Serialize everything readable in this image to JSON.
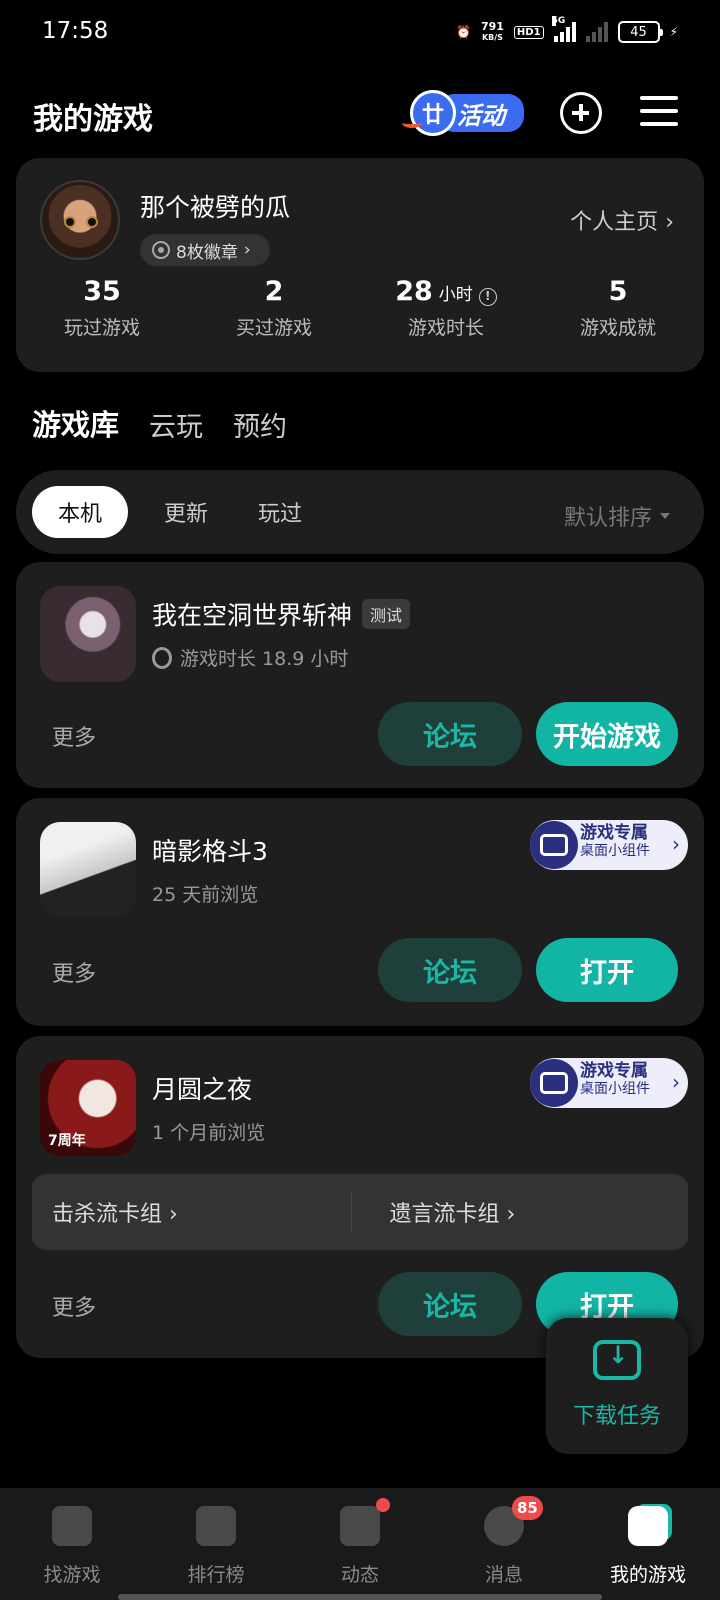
{
  "status_bar": {
    "time": "17:58",
    "net_speed": "791",
    "net_unit": "KB/S",
    "hd": "HD1",
    "signal_tag": "5G",
    "battery": "45"
  },
  "header": {
    "title": "我的游戏",
    "activity_label": "活动",
    "activity_mark": "廿"
  },
  "profile": {
    "name": "那个被劈的瓜",
    "badges": "8枚徽章",
    "homepage_link": "个人主页",
    "stats": [
      {
        "value": "35",
        "unit": "",
        "label": "玩过游戏"
      },
      {
        "value": "2",
        "unit": "",
        "label": "买过游戏"
      },
      {
        "value": "28",
        "unit": "小时",
        "label": "游戏时长"
      },
      {
        "value": "5",
        "unit": "",
        "label": "游戏成就"
      }
    ]
  },
  "tabs": [
    "游戏库",
    "云玩",
    "预约"
  ],
  "filters": {
    "chips": [
      "本机",
      "更新",
      "玩过"
    ],
    "sort": "默认排序"
  },
  "games": [
    {
      "name": "我在空洞世界斩神",
      "tag": "测试",
      "sub": "游戏时长 18.9 小时",
      "more": "更多",
      "forum": "论坛",
      "action": "开始游戏"
    },
    {
      "name": "暗影格斗3",
      "sub": "25 天前浏览",
      "widget_title": "游戏专属",
      "widget_sub": "桌面小组件",
      "more": "更多",
      "forum": "论坛",
      "action": "打开"
    },
    {
      "name": "月圆之夜",
      "icon_text": "7周年",
      "sub": "1 个月前浏览",
      "widget_title": "游戏专属",
      "widget_sub": "桌面小组件",
      "decks": [
        "击杀流卡组",
        "遗言流卡组"
      ],
      "more": "更多",
      "forum": "论坛",
      "action": "打开"
    }
  ],
  "download_task": "下载任务",
  "bottom_nav": [
    {
      "label": "找游戏"
    },
    {
      "label": "排行榜"
    },
    {
      "label": "动态"
    },
    {
      "label": "消息",
      "badge": "85"
    },
    {
      "label": "我的游戏"
    }
  ],
  "colors": {
    "accent": "#19b7a5",
    "card_bg": "#1e1e1e",
    "page_bg": "#000000"
  }
}
